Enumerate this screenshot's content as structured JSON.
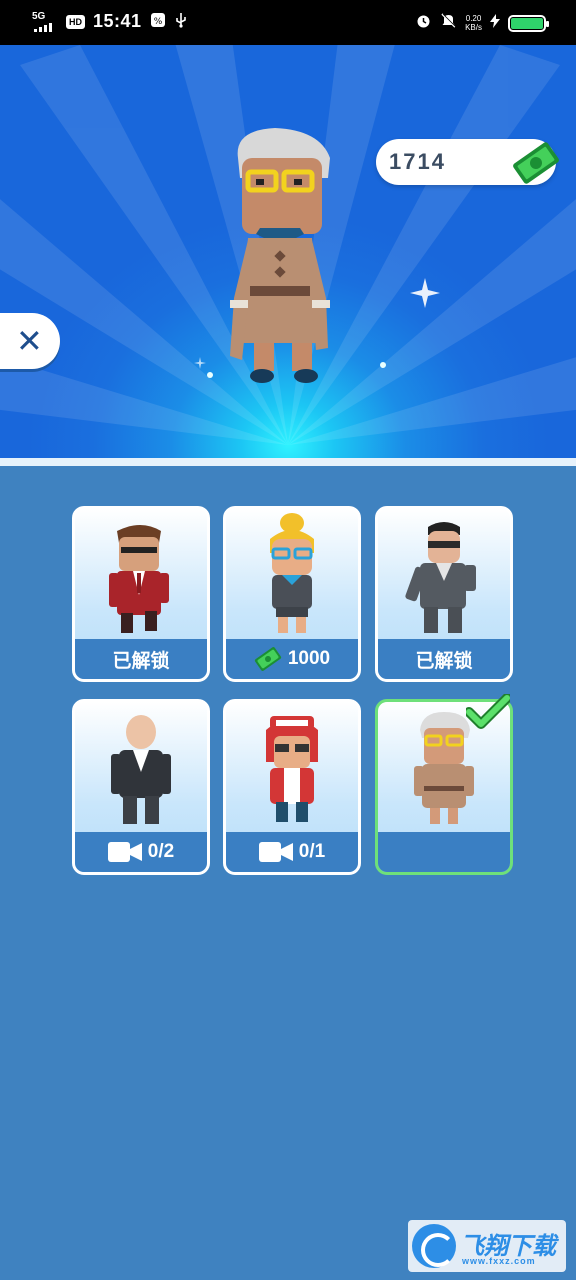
{
  "status_bar": {
    "network": "5G",
    "hd": "HD",
    "time": "15:41",
    "speed_value": "0.20",
    "speed_unit": "KB/s",
    "battery_level": 1.0
  },
  "currency": {
    "amount": "1714"
  },
  "colors": {
    "selected_border": "#6ee07a",
    "card_bar": "#3a7fc3",
    "background": "#3f82c0"
  },
  "characters": [
    {
      "id": "suit-man",
      "status": "已解锁"
    },
    {
      "id": "blonde-girl",
      "price": "1000"
    },
    {
      "id": "black-suit-man",
      "status": "已解锁"
    },
    {
      "id": "bald-man",
      "progress": "0/2"
    },
    {
      "id": "cap-girl",
      "progress": "0/1"
    },
    {
      "id": "grandma",
      "status": "",
      "selected": true
    }
  ],
  "watermark": {
    "brand": "飞翔下载",
    "site": "www.fxxz.com"
  }
}
